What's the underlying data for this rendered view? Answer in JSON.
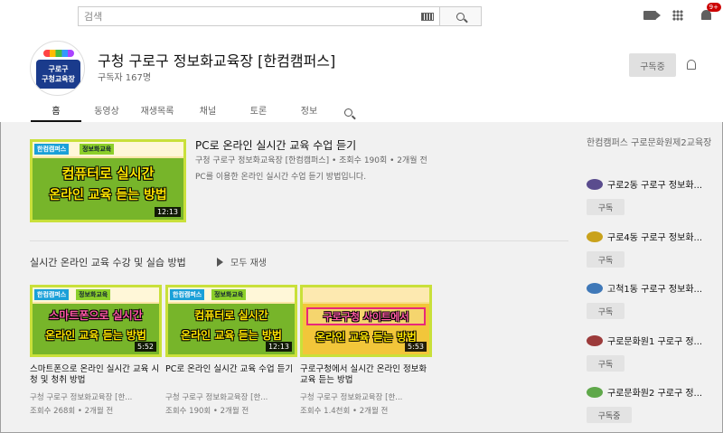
{
  "search": {
    "placeholder": "검색"
  },
  "topbar": {
    "notification_count": "9+"
  },
  "channel": {
    "avatar_text_line1": "구로구",
    "avatar_text_line2": "구청교육장",
    "title": "구청 구로구 정보화교육장 [한컴캠퍼스]",
    "subscribers": "구독자 167명",
    "subscribe_label": "구독중"
  },
  "tabs": [
    {
      "label": "홈",
      "active": true
    },
    {
      "label": "동영상"
    },
    {
      "label": "재생목록"
    },
    {
      "label": "채널"
    },
    {
      "label": "토론"
    },
    {
      "label": "정보"
    }
  ],
  "featured": {
    "title": "PC로 온라인 실시간 교육 수업 듣기",
    "meta": "구청 구로구 정보화교육장 [한컴캠퍼스] • 조회수 190회 • 2개월 전",
    "description": "PC를 이용한 온라인 실시간 수업 듣기 방법입니다.",
    "thumb": {
      "tag1": "한컴캠퍼스",
      "tag2": "정보화교육",
      "line1": "컴퓨터로 실시간",
      "line2": "온라인 교육 듣는 방법",
      "duration": "12:13"
    }
  },
  "section": {
    "title": "실시간 온라인 교육 수강 및 실습 방법",
    "play_all": "모두 재생"
  },
  "videos": [
    {
      "title": "스마트폰으로 온라인 실시간 교육 시청 및 청취 방법",
      "channel": "구청 구로구 정보화교육장 [한...",
      "meta": "조회수 268회 • 2개월 전",
      "thumb": {
        "tag1": "한컴캠퍼스",
        "tag2": "정보화교육",
        "line1": "스마트폰으로 실시간",
        "line2": "온라인 교육 듣는 방법",
        "duration": "5:52"
      }
    },
    {
      "title": "PC로 온라인 실시간 교육 수업 듣기",
      "channel": "구청 구로구 정보화교육장 [한...",
      "meta": "조회수 190회 • 2개월 전",
      "thumb": {
        "tag1": "한컴캠퍼스",
        "tag2": "정보화교육",
        "line1": "컴퓨터로 실시간",
        "line2": "온라인 교육 듣는 방법",
        "duration": "12:13"
      }
    },
    {
      "title": "구로구청에서 실시간 온라인 정보화교육 듣는 방법",
      "channel": "구청 구로구 정보화교육장 [한...",
      "meta": "조회수 1.4천회 • 2개월 전",
      "thumb": {
        "tag1": "",
        "tag2": "",
        "line1": "구로구청 사이트에서",
        "line2": "온라인 교육 듣는 방법",
        "duration": "5:53"
      }
    }
  ],
  "sidebar": {
    "title": "한컴캠퍼스 구로문화원제2교육장",
    "channels": [
      {
        "name": "구로2동 구로구 정보화...",
        "button": "구독",
        "color": "#5a4c8e"
      },
      {
        "name": "구로4동 구로구 정보화...",
        "button": "구독",
        "color": "#c9a21c"
      },
      {
        "name": "고척1동 구로구 정보화...",
        "button": "구독",
        "color": "#3f78b8"
      },
      {
        "name": "구로문화원1 구로구 정...",
        "button": "구독",
        "color": "#9c3b3b"
      },
      {
        "name": "구로문화원2 구로구 정...",
        "button": "구독중",
        "color": "#5fa84a"
      }
    ]
  }
}
